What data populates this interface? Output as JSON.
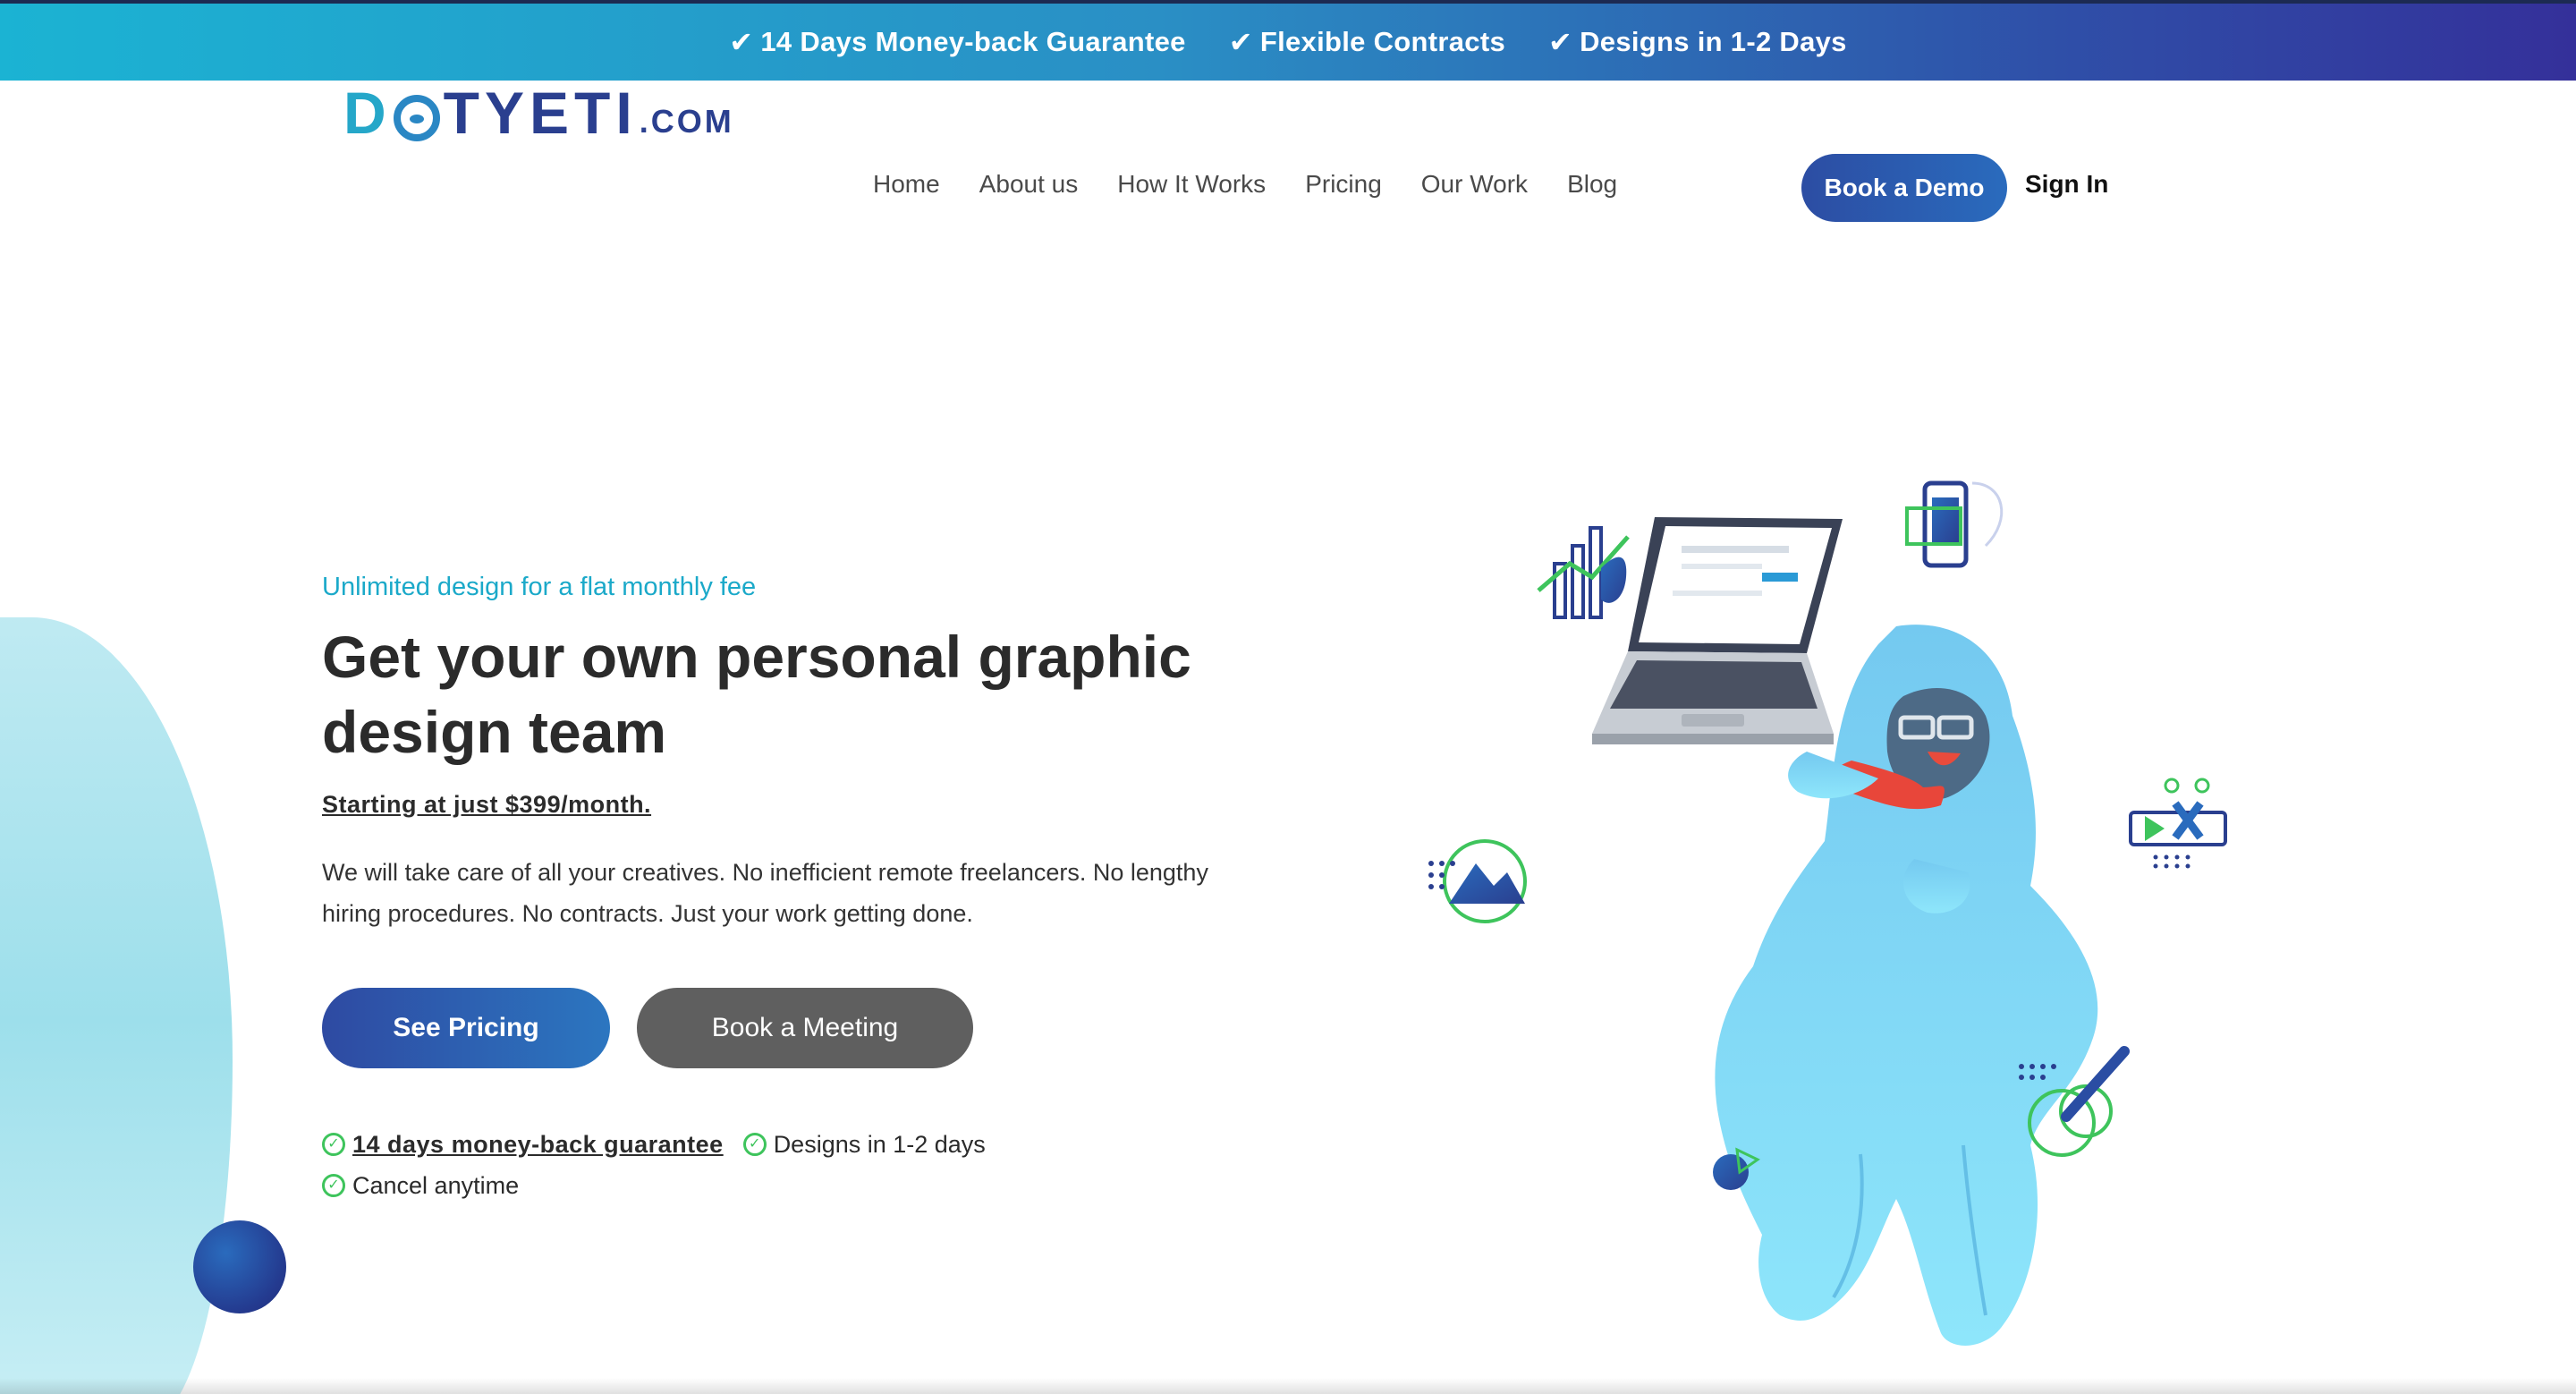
{
  "banner": {
    "items": [
      {
        "check": "✔",
        "text": "14 Days Money-back Guarantee"
      },
      {
        "check": "✔",
        "text": "Flexible Contracts"
      },
      {
        "check": "✔",
        "text": "Designs in 1-2 Days"
      }
    ]
  },
  "logo": {
    "text_d": "D",
    "text_rest": "TYETI",
    "suffix": ".COM"
  },
  "nav": {
    "items": [
      "Home",
      "About us",
      "How It Works",
      "Pricing",
      "Our Work",
      "Blog"
    ],
    "book_demo": "Book a Demo",
    "sign_in": "Sign In"
  },
  "hero": {
    "eyebrow": "Unlimited design for a flat monthly fee",
    "headline": "Get your own personal graphic design team",
    "price_link": "Starting at just $399/month.",
    "body": "We will take care of all your creatives. No inefficient remote freelancers. No lengthy hiring procedures. No contracts. Just your work getting done.",
    "primary_cta": "See Pricing",
    "secondary_cta": "Book a Meeting",
    "checks": [
      {
        "text": "14 days money-back guarantee"
      },
      {
        "text": "Designs in 1-2 days"
      },
      {
        "text": "Cancel anytime"
      }
    ],
    "check_glyph": "✓"
  },
  "colors": {
    "accent_teal": "#1ba9c9",
    "brand_blue": "#2c4da3",
    "check_green": "#3ec45c",
    "yeti_blue": "#7fd9f2"
  },
  "icons": [
    "check-icon",
    "yeti-mascot",
    "laptop-icon",
    "phone-icon",
    "chart-icon",
    "image-icon",
    "pen-icon",
    "design-tools-icon"
  ]
}
